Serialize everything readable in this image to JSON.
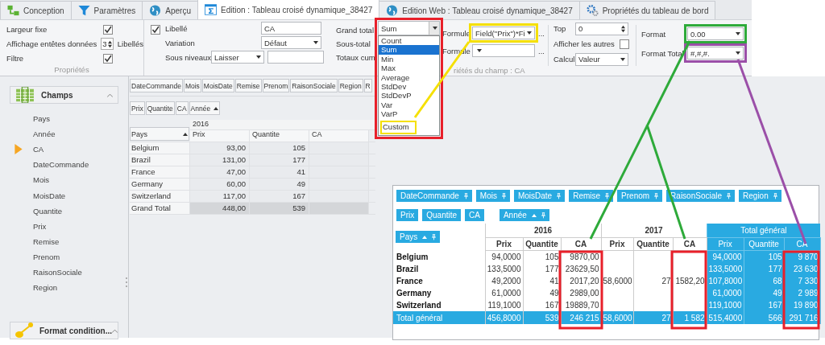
{
  "tabs": [
    {
      "label": "Conception",
      "selected": false
    },
    {
      "label": "Paramètres",
      "selected": false
    },
    {
      "label": "Aperçu",
      "selected": false
    },
    {
      "label": "Edition : Tableau croisé dynamique_38427",
      "selected": true
    },
    {
      "label": "Edition Web : Tableau croisé dynamique_38427",
      "selected": false
    },
    {
      "label": "Propriétés du tableau de bord",
      "selected": false
    }
  ],
  "properties_group": {
    "caption": "Propriétés",
    "rows": [
      {
        "kind": "check",
        "label": "Largeur fixe",
        "checked": true
      },
      {
        "kind": "spin",
        "label": "Affichage entêtes données",
        "value": "3",
        "suffix": "Libellés"
      },
      {
        "kind": "check",
        "label": "Filtre",
        "checked": true
      }
    ]
  },
  "field_group": {
    "caption": "riétés du champ : CA",
    "checked": true,
    "libelle": {
      "label": "Libellé",
      "value": "CA"
    },
    "variation": {
      "label": "Variation",
      "value": "Défaut"
    },
    "sous_niveaux": {
      "label": "Sous niveaux",
      "value": "Laisser"
    },
    "totals_labels": [
      "Grand total",
      "Sous-total",
      "Totaux cum"
    ],
    "grand_total": {
      "value": "Sum",
      "options": [
        {
          "label": "Count",
          "selected": false
        },
        {
          "label": "Sum",
          "selected": true
        },
        {
          "label": "Min",
          "selected": false
        },
        {
          "label": "Max",
          "selected": false
        },
        {
          "label": "Average",
          "selected": false
        },
        {
          "label": "StdDev",
          "selected": false
        },
        {
          "label": "StdDevP",
          "selected": false
        },
        {
          "label": "Var",
          "selected": false
        },
        {
          "label": "VarP",
          "selected": false
        },
        {
          "label": "Custom",
          "selected": false
        }
      ]
    },
    "formule_1": {
      "label": "Formule",
      "value": "Field(\"Prix\")*Fi",
      "more": "..."
    },
    "formule_2": {
      "label": "Formule",
      "more": "..."
    },
    "top": {
      "label": "Top",
      "value": "0"
    },
    "afficher_autres": {
      "label": "Afficher les autres",
      "checked": false
    },
    "calcul": {
      "label": "Calcul",
      "value": "Valeur"
    },
    "format": {
      "label": "Format",
      "value": "0.00"
    },
    "format_total": {
      "label": "Format Total",
      "value": "#,#,#."
    }
  },
  "fields_panel": {
    "title": "Champs",
    "items": [
      {
        "label": "Pays",
        "selected": false
      },
      {
        "label": "Année",
        "selected": false
      },
      {
        "label": "CA",
        "selected": true
      },
      {
        "label": "DateCommande",
        "selected": false
      },
      {
        "label": "Mois",
        "selected": false
      },
      {
        "label": "MoisDate",
        "selected": false
      },
      {
        "label": "Quantite",
        "selected": false
      },
      {
        "label": "Prix",
        "selected": false
      },
      {
        "label": "Remise",
        "selected": false
      },
      {
        "label": "Prenom",
        "selected": false
      },
      {
        "label": "RaisonSociale",
        "selected": false
      },
      {
        "label": "Region",
        "selected": false
      }
    ],
    "footer_title": "Format condition..."
  },
  "pivot": {
    "filter_fields": [
      "DateCommande",
      "Mois",
      "MoisDate",
      "Remise",
      "Prenom",
      "RaisonSociale",
      "Region",
      "R"
    ],
    "data_fields": [
      "Prix",
      "Quantite",
      "CA"
    ],
    "column_field": "Année",
    "row_field": "Pays",
    "year": "2016",
    "measures": [
      "Prix",
      "Quantite",
      "CA"
    ],
    "rows": [
      {
        "kind": "data",
        "label": "Belgium",
        "cells": [
          "93,00",
          "105",
          ""
        ]
      },
      {
        "kind": "data",
        "label": "Brazil",
        "cells": [
          "131,00",
          "177",
          ""
        ]
      },
      {
        "kind": "data",
        "label": "France",
        "cells": [
          "47,00",
          "41",
          ""
        ]
      },
      {
        "kind": "data",
        "label": "Germany",
        "cells": [
          "60,00",
          "49",
          ""
        ]
      },
      {
        "kind": "data",
        "label": "Switzerland",
        "cells": [
          "117,00",
          "167",
          ""
        ]
      },
      {
        "kind": "total",
        "label": "Grand Total",
        "cells": [
          "448,00",
          "539",
          ""
        ]
      }
    ]
  },
  "web_pivot": {
    "filter_fields": [
      "DateCommande",
      "Mois",
      "MoisDate",
      "Remise",
      "Prenom",
      "RaisonSociale",
      "Region"
    ],
    "data_fields": [
      "Prix",
      "Quantite",
      "CA"
    ],
    "column_field": "Année",
    "row_field": "Pays",
    "groups": [
      {
        "kind": "year",
        "label": "2016",
        "measures": [
          "Prix",
          "Quantite",
          "CA"
        ]
      },
      {
        "kind": "year",
        "label": "2017",
        "measures": [
          "Prix",
          "Quantite",
          "CA"
        ]
      },
      {
        "kind": "total",
        "label": "Total général",
        "measures": [
          "Prix",
          "Quantite",
          "CA"
        ]
      }
    ],
    "rows": [
      {
        "kind": "data",
        "label": "Belgium",
        "cells": [
          "94,0000",
          "105",
          "9870,00",
          "",
          "",
          "",
          "94,0000",
          "105",
          "9 870"
        ]
      },
      {
        "kind": "data",
        "label": "Brazil",
        "cells": [
          "133,5000",
          "177",
          "23629,50",
          "",
          "",
          "",
          "133,5000",
          "177",
          "23 630"
        ]
      },
      {
        "kind": "data",
        "label": "France",
        "cells": [
          "49,2000",
          "41",
          "2017,20",
          "58,6000",
          "27",
          "1582,20",
          "107,8000",
          "68",
          "7 330"
        ]
      },
      {
        "kind": "data",
        "label": "Germany",
        "cells": [
          "61,0000",
          "49",
          "2989,00",
          "",
          "",
          "",
          "61,0000",
          "49",
          "2 989"
        ]
      },
      {
        "kind": "data",
        "label": "Switzerland",
        "cells": [
          "119,1000",
          "167",
          "19889,70",
          "",
          "",
          "",
          "119,1000",
          "167",
          "19 890"
        ]
      },
      {
        "kind": "total",
        "label": "Total général",
        "cells": [
          "456,8000",
          "539",
          "246 215",
          "58,6000",
          "27",
          "1 582",
          "515,4000",
          "566",
          "291 716"
        ]
      }
    ]
  }
}
